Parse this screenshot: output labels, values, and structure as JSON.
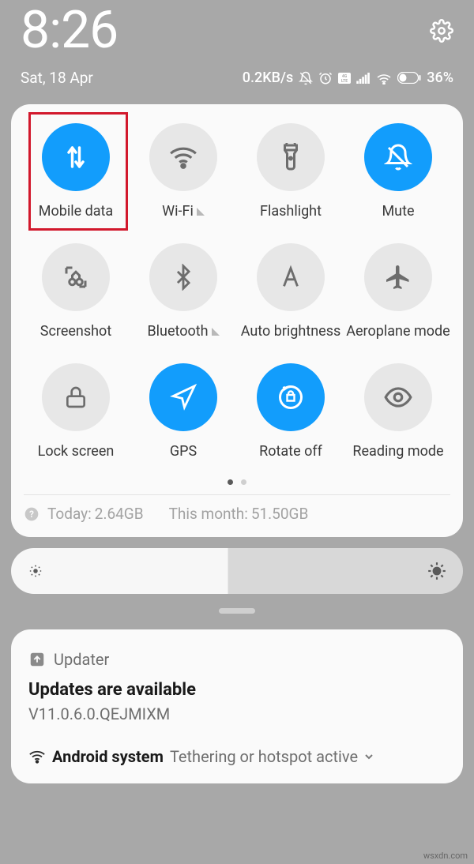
{
  "header": {
    "time": "8:26",
    "date": "Sat, 18 Apr",
    "data_speed": "0.2KB/s",
    "battery": "36%"
  },
  "tiles": [
    {
      "id": "mobile-data",
      "label": "Mobile data",
      "active": true,
      "highlighted": true,
      "chevron": false
    },
    {
      "id": "wifi",
      "label": "Wi-Fi",
      "active": false,
      "chevron": true
    },
    {
      "id": "flashlight",
      "label": "Flashlight",
      "active": false,
      "chevron": false
    },
    {
      "id": "mute",
      "label": "Mute",
      "active": true,
      "chevron": false
    },
    {
      "id": "screenshot",
      "label": "Screenshot",
      "active": false,
      "chevron": false
    },
    {
      "id": "bluetooth",
      "label": "Bluetooth",
      "active": false,
      "chevron": true
    },
    {
      "id": "auto-brightness",
      "label": "Auto brightness",
      "active": false,
      "chevron": false
    },
    {
      "id": "aeroplane-mode",
      "label": "Aeroplane mode",
      "active": false,
      "chevron": false
    },
    {
      "id": "lock-screen",
      "label": "Lock screen",
      "active": false,
      "chevron": false
    },
    {
      "id": "gps",
      "label": "GPS",
      "active": true,
      "chevron": false
    },
    {
      "id": "rotate-off",
      "label": "Rotate off",
      "active": true,
      "chevron": false
    },
    {
      "id": "reading-mode",
      "label": "Reading mode",
      "active": false,
      "chevron": false
    }
  ],
  "usage": {
    "today_label": "Today:",
    "today_value": "2.64GB",
    "month_label": "This month:",
    "month_value": "51.50GB"
  },
  "notification": {
    "app": "Updater",
    "title": "Updates are available",
    "body": "V11.0.6.0.QEJMIXM",
    "sub_app": "Android system",
    "sub_text": "Tethering or hotspot active"
  },
  "watermark": "wsxdn.com"
}
